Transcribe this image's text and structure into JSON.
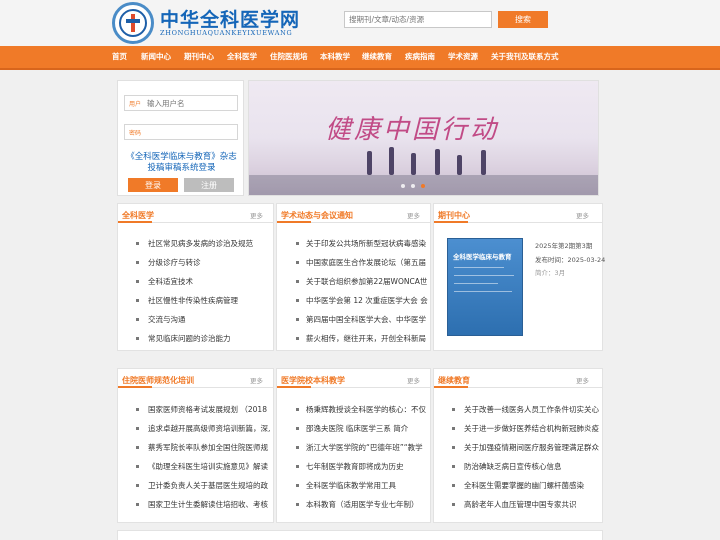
{
  "header": {
    "site_title": "中华全科医学网",
    "site_subtitle": "ZHONGHUAQUANKEYIXUEWANG",
    "search_placeholder": "搜期刊/文章/动态/资源",
    "search_button": "搜索"
  },
  "nav": [
    "首页",
    "新闻中心",
    "期刊中心",
    "全科医学",
    "住院医规培",
    "本科教学",
    "继续教育",
    "疾病指南",
    "学术资源",
    "关于我刊及联系方式"
  ],
  "login": {
    "user_label": "用户",
    "user_placeholder": "输入用户名",
    "password_label": "密码",
    "title_line1": "《全科医学临床与教育》杂志",
    "title_line2": "投稿审稿系统登录",
    "login_button": "登录",
    "register_button": "注册"
  },
  "banner": {
    "text": "健康中国行动"
  },
  "more_label": "更多",
  "sections": {
    "general_medicine": {
      "title": "全科医学",
      "items": [
        "社区常见病多发病的诊治及规范",
        "分级诊疗与转诊",
        "全科适宜技术",
        "社区慢性非传染性疾病管理",
        "交流与沟通",
        "常见临床问题的诊治能力"
      ]
    },
    "academic_news": {
      "title": "学术动态与会议通知",
      "items": [
        "关于印发公共场所新型冠状病毒感染",
        "中国家庭医生合作发展论坛（第五届",
        "关于联合组织参加第22届WONCA世",
        "中华医学会第 12 次重症医学大会 会",
        "第四届中国全科医学大会、中华医学",
        "薪火相传，继往开来，开创全科新局"
      ]
    },
    "journal_center": {
      "title": "期刊中心",
      "cover_title": "全科医学临床与教育",
      "issue": "2025年第2期第3期",
      "publish_date": "发布时间：2025-03-24",
      "intro": "简介：3月"
    },
    "resident_training": {
      "title": "住院医师规范化培训",
      "items": [
        "国家医师资格考试发展规划 （2018",
        "追求卓越开展高级师资培训新篇，深入",
        "蔡秀军院长率队参加全国住院医师规",
        "《助理全科医生培训实施意见》解读",
        "卫计委负责人关于基层医生规培的政",
        "国家卫生计生委解读住培招收、考核"
      ]
    },
    "undergrad_teaching": {
      "title": "医学院校本科教学",
      "items": [
        "杨秉辉教授谈全科医学的核心：不仅",
        "邵逸夫医院 临床医学三系 简介",
        "浙江大学医学院的“巴德年班”“教学",
        "七年制医学教育即将成为历史",
        "全科医学临床教学常用工具",
        "本科教育（适用医学专业七年制）"
      ]
    },
    "continuing_education": {
      "title": "继续教育",
      "items": [
        "关于改善一线医务人员工作条件切实关心",
        "关于进一步做好医养结合机构新冠肺炎疫",
        "关于加强疫情期间医疗服务管理满足群众",
        "防治碘缺乏病日宣传核心信息",
        "全科医生需要掌握的幽门螺杆菌感染",
        "高龄老年人血压管理中国专家共识"
      ]
    }
  }
}
